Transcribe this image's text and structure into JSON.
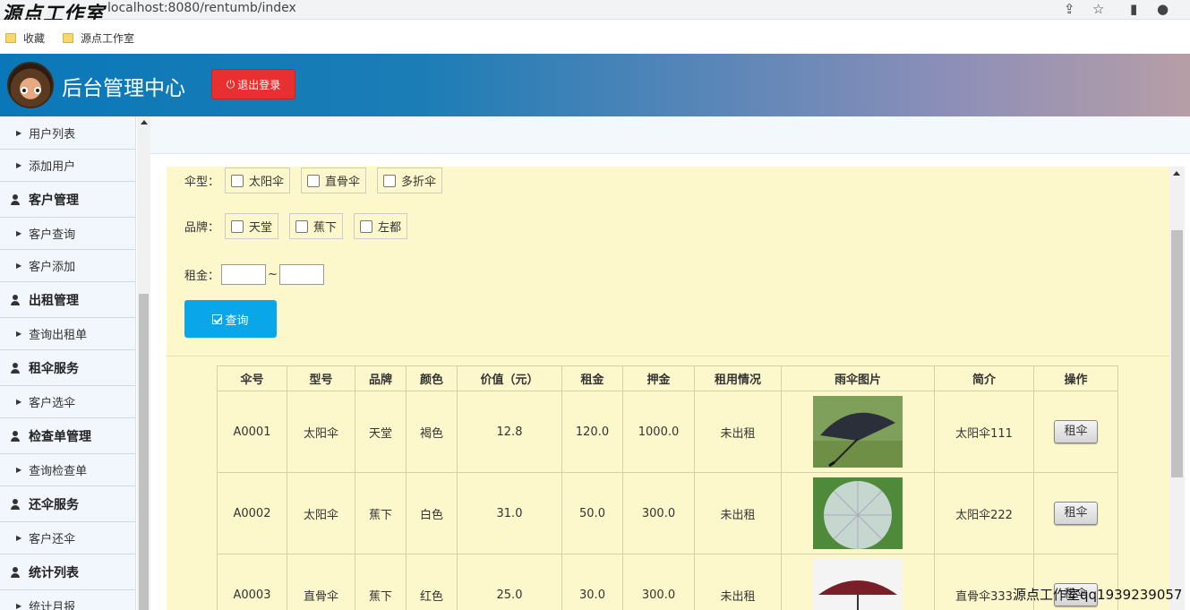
{
  "browser": {
    "watermark": "源点工作室",
    "url": "localhost:8080/rentumb/index",
    "bookmarks": [
      "收藏",
      "源点工作室"
    ]
  },
  "header": {
    "title": "后台管理中心",
    "logout_label": "退出登录"
  },
  "sidebar": {
    "items": [
      {
        "type": "sub",
        "label": "用户列表"
      },
      {
        "type": "sub",
        "label": "添加用户"
      },
      {
        "type": "group",
        "label": "客户管理"
      },
      {
        "type": "sub",
        "label": "客户查询"
      },
      {
        "type": "sub",
        "label": "客户添加"
      },
      {
        "type": "group",
        "label": "出租管理"
      },
      {
        "type": "sub",
        "label": "查询出租单"
      },
      {
        "type": "group",
        "label": "租伞服务"
      },
      {
        "type": "sub",
        "label": "客户选伞"
      },
      {
        "type": "group",
        "label": "检查单管理"
      },
      {
        "type": "sub",
        "label": "查询检查单"
      },
      {
        "type": "group",
        "label": "还伞服务"
      },
      {
        "type": "sub",
        "label": "客户还伞"
      },
      {
        "type": "group",
        "label": "统计列表"
      },
      {
        "type": "sub",
        "label": "统计月报"
      }
    ]
  },
  "filter": {
    "type_label": "伞型：",
    "types": [
      "太阳伞",
      "直骨伞",
      "多折伞"
    ],
    "brand_label": "品牌：",
    "brands": [
      "天堂",
      "蕉下",
      "左都"
    ],
    "rent_label": "租金：",
    "rent_sep": "~",
    "query_label": "查询"
  },
  "table": {
    "headers": [
      "伞号",
      "型号",
      "品牌",
      "颜色",
      "价值（元）",
      "租金",
      "押金",
      "租用情况",
      "雨伞图片",
      "简介",
      "操作"
    ],
    "rows": [
      {
        "id": "A0001",
        "model": "太阳伞",
        "brand": "天堂",
        "color": "褐色",
        "value": "12.8",
        "rent": "120.0",
        "deposit": "1000.0",
        "status": "未出租",
        "intro": "太阳伞111",
        "action": "租伞"
      },
      {
        "id": "A0002",
        "model": "太阳伞",
        "brand": "蕉下",
        "color": "白色",
        "value": "31.0",
        "rent": "50.0",
        "deposit": "300.0",
        "status": "未出租",
        "intro": "太阳伞222",
        "action": "租伞"
      },
      {
        "id": "A0003",
        "model": "直骨伞",
        "brand": "蕉下",
        "color": "红色",
        "value": "25.0",
        "rent": "30.0",
        "deposit": "300.0",
        "status": "未出租",
        "intro": "直骨伞333",
        "action": "租伞"
      }
    ]
  },
  "footer_watermark": "源点工作室qq1939239057"
}
